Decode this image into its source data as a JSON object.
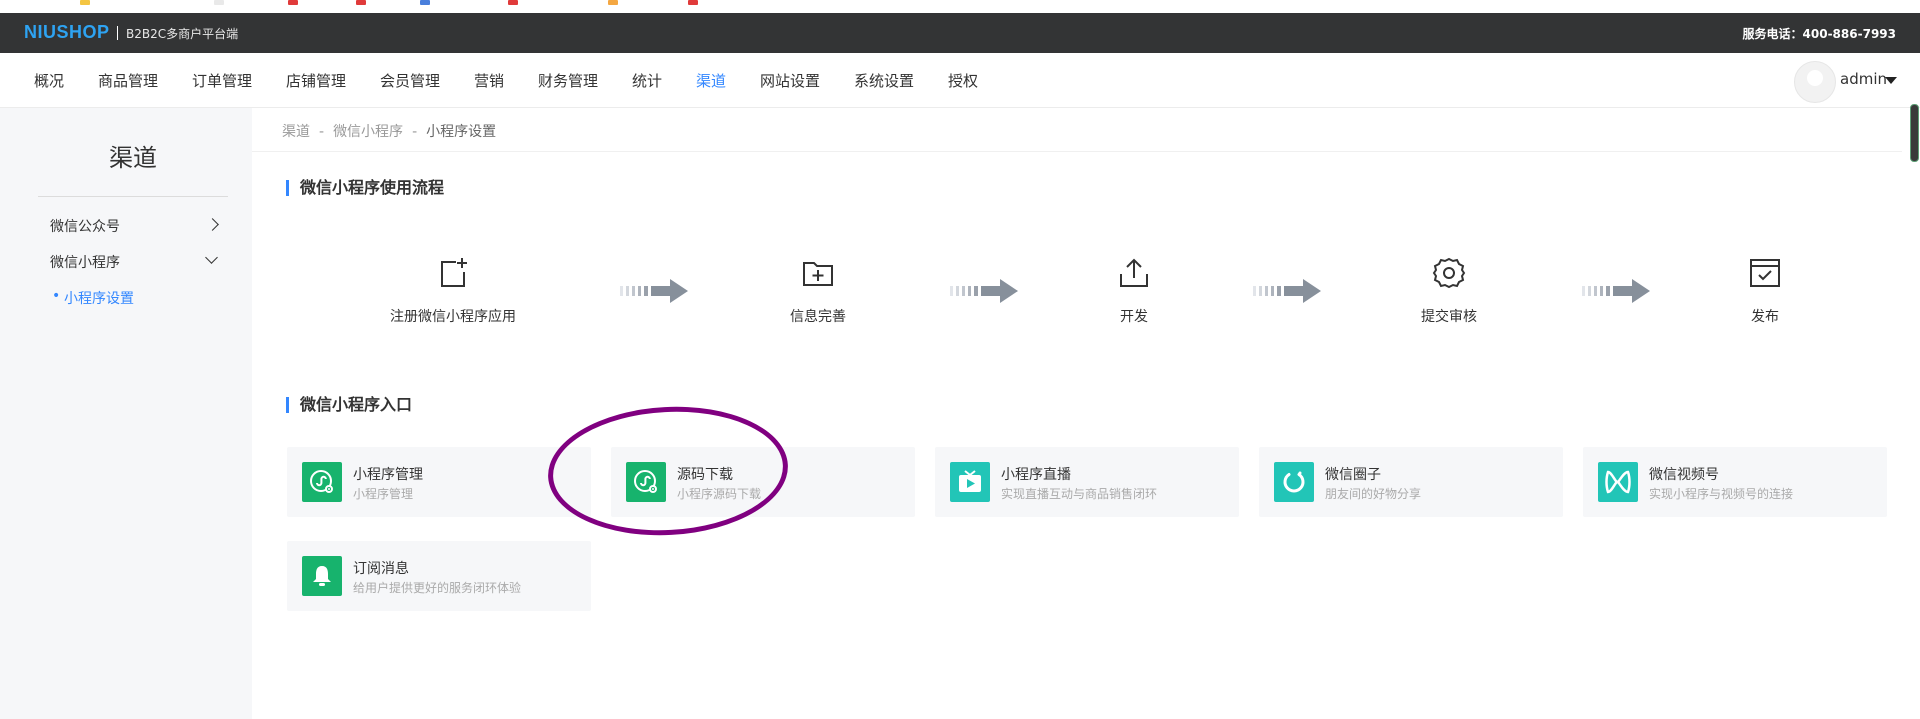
{
  "colors": {
    "accent": "#3387ff",
    "topbar_bg": "#333435",
    "logo": "#2ea3f2",
    "sidebar_bg": "#f6f7f9",
    "card_bg": "#f6f7f9",
    "icon_green": "#17b36d",
    "icon_teal": "#22c5b7",
    "annotation_circle": "#800080"
  },
  "topbar": {
    "logo": "NIUSHOP",
    "platform": "B2B2C多商户平台端",
    "hotline": "服务电话：400-886-7993"
  },
  "nav": {
    "items": [
      {
        "label": "概况",
        "active": false
      },
      {
        "label": "商品管理",
        "active": false
      },
      {
        "label": "订单管理",
        "active": false
      },
      {
        "label": "店铺管理",
        "active": false
      },
      {
        "label": "会员管理",
        "active": false
      },
      {
        "label": "营销",
        "active": false
      },
      {
        "label": "财务管理",
        "active": false
      },
      {
        "label": "统计",
        "active": false
      },
      {
        "label": "渠道",
        "active": true
      },
      {
        "label": "网站设置",
        "active": false
      },
      {
        "label": "系统设置",
        "active": false
      },
      {
        "label": "授权",
        "active": false
      }
    ],
    "user": "admin"
  },
  "sidebar": {
    "title": "渠道",
    "menus": [
      {
        "label": "微信公众号",
        "icon": "chevron-right-icon",
        "expanded": false
      },
      {
        "label": "微信小程序",
        "icon": "chevron-down-icon",
        "expanded": true
      }
    ],
    "sub_item": "小程序设置"
  },
  "breadcrumb": {
    "items": [
      "渠道",
      "微信小程序",
      "小程序设置"
    ],
    "separator": "-"
  },
  "flow": {
    "title": "微信小程序使用流程",
    "steps": [
      {
        "label": "注册微信小程序应用",
        "icon": "register-app-icon"
      },
      {
        "label": "信息完善",
        "icon": "folder-add-icon"
      },
      {
        "label": "开发",
        "icon": "upload-icon"
      },
      {
        "label": "提交审核",
        "icon": "gear-icon"
      },
      {
        "label": "发布",
        "icon": "calendar-check-icon"
      }
    ]
  },
  "entries": {
    "title": "微信小程序入口",
    "cards": [
      {
        "title": "小程序管理",
        "desc": "小程序管理",
        "icon": "miniprogram-settings-icon",
        "color": "#17b36d"
      },
      {
        "title": "源码下载",
        "desc": "小程序源码下载",
        "icon": "miniprogram-settings-icon",
        "color": "#17b36d"
      },
      {
        "title": "小程序直播",
        "desc": "实现直播互动与商品销售闭环",
        "icon": "live-tv-icon",
        "color": "#22c5b7"
      },
      {
        "title": "微信圈子",
        "desc": "朋友间的好物分享",
        "icon": "circle-refresh-icon",
        "color": "#22c5b7"
      },
      {
        "title": "微信视频号",
        "desc": "实现小程序与视频号的连接",
        "icon": "video-channel-icon",
        "color": "#22c5b7"
      },
      {
        "title": "订阅消息",
        "desc": "给用户提供更好的服务闭环体验",
        "icon": "bell-icon",
        "color": "#17b36d"
      }
    ]
  }
}
